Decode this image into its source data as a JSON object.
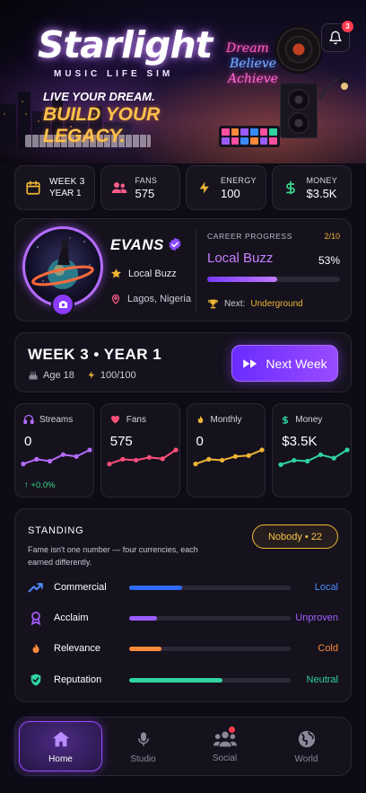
{
  "hero": {
    "logo": "Starlight",
    "logo_sub": "MUSIC LIFE SIM",
    "tagline_line1": "LIVE YOUR DREAM.",
    "tagline_line2": "BUILD YOUR LEGACY.",
    "neon_sign": [
      "Dream",
      "Believe",
      "Achieve"
    ],
    "notification_count": "3"
  },
  "stats": [
    {
      "label": "WEEK 3",
      "value": "YEAR 1",
      "icon": "calendar-icon",
      "color": "#f0b634"
    },
    {
      "label": "FANS",
      "value": "575",
      "icon": "users-icon",
      "color": "#ff5c8a"
    },
    {
      "label": "ENERGY",
      "value": "100",
      "icon": "bolt-icon",
      "color": "#f0b634"
    },
    {
      "label": "MONEY",
      "value": "$3.5K",
      "icon": "dollar-icon",
      "color": "#39d98a"
    }
  ],
  "profile": {
    "name": "EVANS",
    "tier": "Local Buzz",
    "location": "Lagos, Nigeria",
    "career_label": "CAREER PROGRESS",
    "career_count": "2/10",
    "career_tier": "Local Buzz",
    "career_percent": "53%",
    "career_fraction": 0.53,
    "next_label": "Next:",
    "next_tier": "Underground"
  },
  "week": {
    "title": "WEEK 3 • YEAR 1",
    "age": "Age 18",
    "energy": "100/100",
    "next_button": "Next Week"
  },
  "metrics": [
    {
      "label": "Streams",
      "value": "0",
      "icon": "headphones-icon",
      "color": "#b56cff",
      "delta": "+0.0%",
      "trend": [
        2,
        3,
        2.6,
        4,
        3.6,
        5
      ]
    },
    {
      "label": "Fans",
      "value": "575",
      "icon": "heart-icon",
      "color": "#ff4f7a",
      "trend": [
        2,
        3,
        2.8,
        3.4,
        3.1,
        5
      ]
    },
    {
      "label": "Monthly",
      "value": "0",
      "icon": "flame-icon",
      "color": "#f0b634",
      "trend": [
        2,
        3,
        2.8,
        3.6,
        3.8,
        5
      ]
    },
    {
      "label": "Money",
      "value": "$3.5K",
      "icon": "dollar-icon",
      "color": "#2fd3a0",
      "trend": [
        2,
        3,
        2.8,
        4.3,
        3.5,
        5.4
      ]
    }
  ],
  "standing": {
    "title": "STANDING",
    "description": "Fame isn't one number — four currencies, each earned differently.",
    "pill": "Nobody • 22",
    "rows": [
      {
        "name": "Commercial",
        "status": "Local",
        "level": 0.33,
        "color": "#2f6bff",
        "status_color": "#4d8bff",
        "icon": "trending-up-icon"
      },
      {
        "name": "Acclaim",
        "status": "Unproven",
        "level": 0.17,
        "color": "#9b5cff",
        "status_color": "#a45cff",
        "icon": "award-icon"
      },
      {
        "name": "Relevance",
        "status": "Cold",
        "level": 0.2,
        "color": "#ff8a3a",
        "status_color": "#ff8a3a",
        "icon": "fire-icon"
      },
      {
        "name": "Reputation",
        "status": "Neutral",
        "level": 0.58,
        "color": "#2fd3a0",
        "status_color": "#2fd3a0",
        "icon": "shield-check-icon"
      }
    ]
  },
  "nav": [
    {
      "label": "Home",
      "icon": "home-icon",
      "active": true
    },
    {
      "label": "Studio",
      "icon": "microphone-icon",
      "active": false
    },
    {
      "label": "Social",
      "icon": "group-icon",
      "active": false,
      "dot": true
    },
    {
      "label": "World",
      "icon": "globe-icon",
      "active": false
    }
  ]
}
